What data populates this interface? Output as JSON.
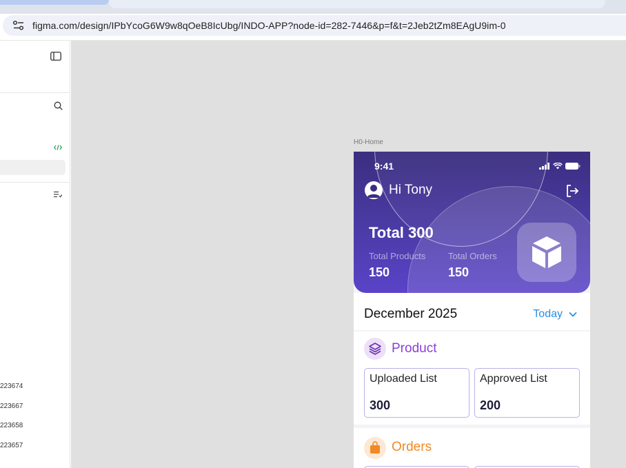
{
  "browser": {
    "url_host": "figma.com",
    "url_path": "/design/IPbYcoG6W9w8qOeB8IcUbg/INDO-APP?node-id=282-7446&p=f&t=2Jeb2tZm8EAgU9im-0"
  },
  "sidebar": {
    "layer_ids": [
      "223674",
      "223667",
      "223658",
      "223657"
    ]
  },
  "canvas": {
    "frame_label": "H0-Home"
  },
  "phone": {
    "status_time": "9:41",
    "greeting": "Hi Tony",
    "total": "Total 300",
    "stats": [
      {
        "label": "Total Products",
        "value": "150"
      },
      {
        "label": "Total Orders",
        "value": "150"
      }
    ],
    "date_title": "December 2025",
    "filter_label": "Today",
    "product": {
      "title": "Product",
      "cards": [
        {
          "label": "Uploaded List",
          "value": "300"
        },
        {
          "label": "Approved List",
          "value": "200"
        }
      ]
    },
    "orders": {
      "title": "Orders"
    }
  },
  "colors": {
    "hero_top": "#3b2e7f",
    "hero_bottom": "#5a43c8",
    "product_accent": "#8a3fd6",
    "orders_accent": "#f08a24",
    "link_blue": "#2b8de0",
    "figma_green": "#1aa251"
  },
  "icons": [
    "site-info-icon",
    "sidebar-toggle-icon",
    "search-icon",
    "code-icon",
    "list-check-icon",
    "avatar-icon",
    "logout-icon",
    "box-icon",
    "layers-icon",
    "shopping-bag-icon",
    "chevron-down-icon",
    "signal-icon",
    "wifi-icon",
    "battery-icon"
  ]
}
